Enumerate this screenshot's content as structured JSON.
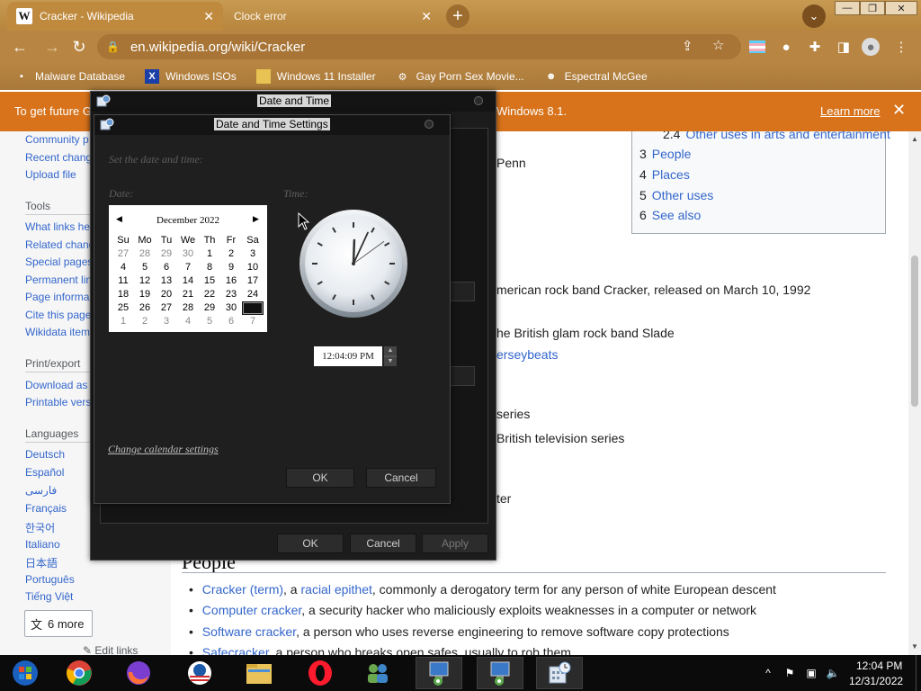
{
  "browser": {
    "tabs": [
      {
        "title": "Cracker - Wikipedia",
        "favicon": "W",
        "active": true
      },
      {
        "title": "Clock error",
        "active": false
      }
    ],
    "url": "en.wikipedia.org/wiki/Cracker",
    "bookmarks": [
      {
        "label": "Malware Database",
        "icon": "bookmark-icon"
      },
      {
        "label": "Windows ISOs",
        "icon": "x-logo-icon"
      },
      {
        "label": "Windows 11 Installer",
        "icon": "folder-icon"
      },
      {
        "label": "Gay Porn Sex Movie...",
        "icon": "gear-icon"
      },
      {
        "label": "Espectral McGee",
        "icon": "avatar-icon"
      }
    ],
    "infobar": {
      "text_left": "To get future G",
      "text_right": "Windows 8.1.",
      "learn_more": "Learn more"
    }
  },
  "wiki": {
    "sidebar": {
      "nav": [
        "Community p",
        "Recent chang",
        "Upload file"
      ],
      "tools_heading": "Tools",
      "tools": [
        "What links he",
        "Related chang",
        "Special pages",
        "Permanent lin",
        "Page informa",
        "Cite this page",
        "Wikidata item"
      ],
      "print_heading": "Print/export",
      "print": [
        "Download as",
        "Printable vers"
      ],
      "languages_heading": "Languages",
      "languages": [
        "Deutsch",
        "Español",
        "فارسی",
        "Français",
        "한국어",
        "Italiano",
        "日本語",
        "Português",
        "Tiếng Việt"
      ],
      "more_languages": "6 more",
      "edit_links": "Edit links"
    },
    "toc": [
      {
        "num": "2.4",
        "label": "Other uses in arts and entertainment"
      },
      {
        "num": "3",
        "label": "People"
      },
      {
        "num": "4",
        "label": "Places"
      },
      {
        "num": "5",
        "label": "Other uses"
      },
      {
        "num": "6",
        "label": "See also"
      }
    ],
    "fragments": {
      "penn": "Penn",
      "rock_band": "merican rock band Cracker, released on March 10, 1992",
      "slade": "he British glam rock band Slade",
      "jerseybeats": "erseybeats",
      "series": "series",
      "british_tv": "British television series",
      "ter": "ter"
    },
    "people_heading": "People",
    "people": [
      {
        "link": "Cracker (term)",
        "sep": ", a ",
        "link2": "racial epithet",
        "rest": ", commonly a derogatory term for any person of white European descent"
      },
      {
        "link": "Computer cracker",
        "rest": ", a security hacker who maliciously exploits weaknesses in a computer or network"
      },
      {
        "link": "Software cracker",
        "rest": ", a person who uses reverse engineering to remove software copy protections"
      },
      {
        "link": "Safecracker",
        "rest": ", a person who breaks open safes, usually to rob them"
      }
    ]
  },
  "date_time_dialog": {
    "title": "Date and Time",
    "ok": "OK",
    "cancel": "Cancel",
    "apply": "Apply"
  },
  "settings_dialog": {
    "title": "Date and Time Settings",
    "instruction": "Set the date and time:",
    "date_label": "Date:",
    "time_label": "Time:",
    "calendar": {
      "month_label": "December 2022",
      "weekdays": [
        "Su",
        "Mo",
        "Tu",
        "We",
        "Th",
        "Fr",
        "Sa"
      ],
      "days": [
        [
          "27",
          "28",
          "29",
          "30",
          "1",
          "2",
          "3"
        ],
        [
          "4",
          "5",
          "6",
          "7",
          "8",
          "9",
          "10"
        ],
        [
          "11",
          "12",
          "13",
          "14",
          "15",
          "16",
          "17"
        ],
        [
          "18",
          "19",
          "20",
          "21",
          "22",
          "23",
          "24"
        ],
        [
          "25",
          "26",
          "27",
          "28",
          "29",
          "30",
          "31"
        ],
        [
          "1",
          "2",
          "3",
          "4",
          "5",
          "6",
          "7"
        ]
      ],
      "selected_day": "31"
    },
    "time_value": "12:04:09 PM",
    "change_calendar": "Change calendar settings",
    "ok": "OK",
    "cancel": "Cancel"
  },
  "taskbar": {
    "apps": [
      "windows-start-icon",
      "chrome-icon",
      "firefox-icon",
      "obama-logo-icon",
      "file-explorer-icon",
      "opera-icon",
      "network-users-icon",
      "control-panel-icon",
      "control-panel-icon",
      "date-time-icon"
    ],
    "clock_time": "12:04 PM",
    "clock_date": "12/31/2022"
  }
}
